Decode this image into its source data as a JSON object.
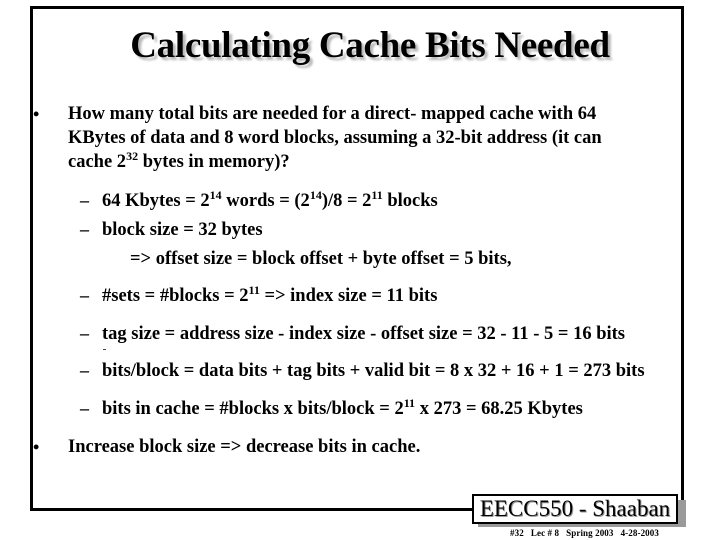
{
  "slide": {
    "title": "Calculating Cache Bits Needed",
    "bullets": [
      {
        "symbol": "•",
        "lines": [
          "How many total bits are needed for a direct- mapped cache with 64",
          "KBytes of data and 8 word blocks, assuming a 32-bit address (it can"
        ],
        "line3_prefix": "cache 2",
        "line3_sup": "32",
        "line3_suffix": " bytes in memory)?"
      },
      {
        "symbol": "•",
        "text": "Increase block size  =>  decrease bits in cache."
      }
    ],
    "dash_symbol": "–",
    "subitems": {
      "kbytes": {
        "p1": "64 Kbytes  =  2",
        "s1": "14",
        "p2": " words  = (2",
        "s2": "14",
        "p3": ")/8 = 2",
        "s3": "11",
        "p4": " blocks"
      },
      "block_size": "block size  =  32 bytes",
      "offset": "=>   offset size   =  block offset  +  byte offset =  5 bits,",
      "sets": {
        "p1": "#sets  =   #blocks  = 2",
        "s1": "11",
        "p2": "  =>   index size  = 11 bits"
      },
      "tag": "tag size = address size -  index size  -  offset size = 32 - 11 - 5 =  16 bits",
      "bits_block": "bits/block = data bits + tag bits + valid bit = 8 x 32 + 16 + 1 = 273 bits",
      "bits_cache": {
        "p1": "bits in cache  =  #blocks x bits/block = 2",
        "s1": "11",
        "p2": " x 273 = 68.25 Kbytes"
      }
    }
  },
  "footer": {
    "badge": "EECC550 - Shaaban",
    "slide_number": "#32",
    "lecture": "Lec # 8",
    "term": "Spring 2003",
    "date": "4-28-2003"
  }
}
